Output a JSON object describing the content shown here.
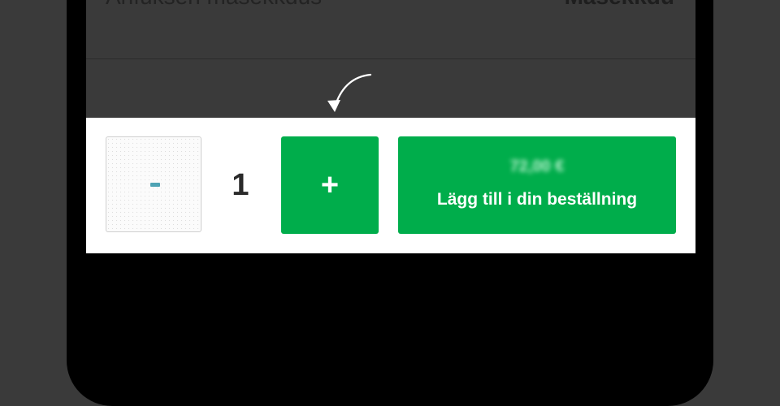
{
  "header": {
    "left_text": "Anfuksen mäsekkdus",
    "right_text": "Mäsekkdu"
  },
  "product": {
    "thumbnail_icon": "product-thumbnail"
  },
  "quantity": {
    "value": "1"
  },
  "increment_button": {
    "label": "+"
  },
  "add_to_order_button": {
    "price": "72,00 €",
    "label": "Lägg till i din beställning"
  },
  "colors": {
    "accent_green": "#00ad4b",
    "phone_bezel": "#000000",
    "screen_dim": "#3a3a3a"
  }
}
